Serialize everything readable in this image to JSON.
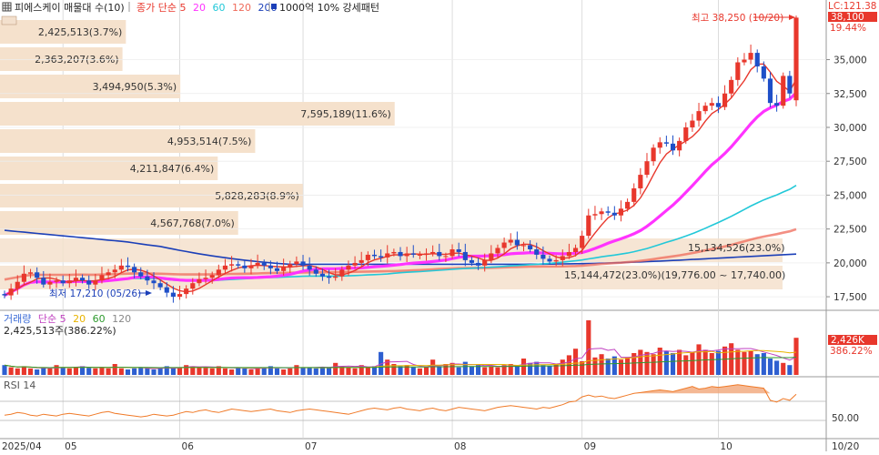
{
  "header": {
    "menu_icon": "grid-menu-icon",
    "title": "피에스케이 매물대 수(10)",
    "ma_legend": [
      {
        "text": "종가 단순 5",
        "color": "#e8372c"
      },
      {
        "text": "20",
        "color": "#ff33ff"
      },
      {
        "text": "60",
        "color": "#22c8d8"
      },
      {
        "text": "120",
        "color": "#ef6a5a"
      },
      {
        "text": "200",
        "color": "#1b3fb8"
      }
    ],
    "pattern_label": "1000억 10% 강세패턴",
    "lc_label": "LC:121.38"
  },
  "price_tags": {
    "current": "38,100",
    "current_pct": "19.44%",
    "current_bg": "#e8372c"
  },
  "annotations": {
    "high": "최고 38,250 (10/20)",
    "low": "최저 17,210 (05/26)",
    "band_left": "15,144,472(23.0%)(19,776.00 ~ 17,740.00)",
    "band_right": "15,134,526(23.0%)"
  },
  "volume_panel": {
    "legend": [
      {
        "text": "거래량",
        "color": "#3a6bd6"
      },
      {
        "text": "단순 5",
        "color": "#c040c0"
      },
      {
        "text": "20",
        "color": "#e8b400"
      },
      {
        "text": "60",
        "color": "#2e9a2e"
      },
      {
        "text": "120",
        "color": "#888888"
      }
    ],
    "value_text": "2,425,513주(386.22%)",
    "tag": "2,426K",
    "tag_pct": "386.22%"
  },
  "rsi_panel": {
    "label": "RSI 14",
    "tick": "50.00"
  },
  "chart_data": {
    "type": "candlestick",
    "title": "피에스케이 매물대 수(10)",
    "y_axis_ticks": [
      "35,000",
      "32,500",
      "30,000",
      "27,500",
      "25,000",
      "22,500",
      "20,000",
      "17,500"
    ],
    "ylim": [
      16700,
      39200
    ],
    "x_axis_labels": [
      "2025/04",
      "05",
      "06",
      "07",
      "08",
      "09",
      "10",
      "10/20"
    ],
    "volume_profile": [
      {
        "label": "2,425,513(3.7%)",
        "share": 3.7
      },
      {
        "label": "2,363,207(3.6%)",
        "share": 3.6
      },
      {
        "label": "3,494,950(5.3%)",
        "share": 5.3
      },
      {
        "label": "7,595,189(11.6%)",
        "share": 11.6
      },
      {
        "label": "4,953,514(7.5%)",
        "share": 7.5
      },
      {
        "label": "4,211,847(6.4%)",
        "share": 6.4
      },
      {
        "label": "5,828,283(8.9%)",
        "share": 8.9
      },
      {
        "label": "4,567,768(7.0%)",
        "share": 7.0
      },
      {
        "label": "",
        "share": 23.0
      },
      {
        "label": "",
        "share": 23.0
      }
    ],
    "high": {
      "value": 38250,
      "date": "10/20"
    },
    "low": {
      "value": 17210,
      "date": "05/26"
    },
    "last_close": 38100,
    "month_ticks": [
      {
        "label": "2025/04",
        "idx": 0
      },
      {
        "label": "05",
        "idx": 9
      },
      {
        "label": "06",
        "idx": 27
      },
      {
        "label": "07",
        "idx": 46
      },
      {
        "label": "08",
        "idx": 69
      },
      {
        "label": "09",
        "idx": 89
      },
      {
        "label": "10",
        "idx": 110
      }
    ],
    "closes": [
      17600,
      18100,
      18600,
      19200,
      19300,
      18900,
      18400,
      18600,
      18700,
      18500,
      18700,
      18900,
      18700,
      18400,
      18700,
      19100,
      19300,
      19500,
      19800,
      19700,
      19300,
      19000,
      18700,
      18500,
      18200,
      17800,
      17500,
      17700,
      18100,
      18500,
      18800,
      18900,
      19100,
      19500,
      19800,
      19900,
      19800,
      19600,
      19800,
      20000,
      19800,
      19600,
      19400,
      19700,
      19900,
      20100,
      19800,
      19500,
      19200,
      19000,
      18900,
      19000,
      19500,
      19800,
      20000,
      20200,
      20600,
      20500,
      20400,
      20700,
      20800,
      20500,
      20700,
      20600,
      20600,
      20700,
      20800,
      20500,
      20500,
      21000,
      20800,
      20200,
      20000,
      19800,
      20200,
      20700,
      21100,
      21500,
      21700,
      21300,
      21300,
      21000,
      20600,
      20300,
      20100,
      20200,
      20500,
      20800,
      21100,
      22000,
      23500,
      23600,
      23800,
      23700,
      23500,
      24000,
      24500,
      25500,
      26500,
      27500,
      28500,
      28900,
      28800,
      28300,
      29000,
      30000,
      30500,
      31200,
      31600,
      31800,
      31500,
      32500,
      33500,
      34800,
      35000,
      35500,
      34500,
      33600,
      31800,
      31600,
      33800,
      32500,
      38100
    ],
    "opens": [
      17700,
      17600,
      18100,
      18600,
      19200,
      19300,
      18900,
      18400,
      18600,
      18700,
      18500,
      18700,
      18900,
      18700,
      18400,
      18700,
      19100,
      19300,
      19500,
      19800,
      19700,
      19300,
      19000,
      18700,
      18500,
      18200,
      17800,
      17500,
      17700,
      18100,
      18500,
      18800,
      18900,
      19100,
      19500,
      19800,
      19900,
      19800,
      19600,
      19800,
      20000,
      19800,
      19600,
      19400,
      19700,
      19900,
      20100,
      19800,
      19500,
      19200,
      19000,
      18900,
      19000,
      19500,
      19800,
      20000,
      20200,
      20600,
      20500,
      20400,
      20700,
      20800,
      20500,
      20700,
      20600,
      20600,
      20700,
      20800,
      20500,
      20500,
      21000,
      20800,
      20200,
      20000,
      19800,
      20200,
      20700,
      21100,
      21500,
      21700,
      21300,
      21300,
      21000,
      20600,
      20300,
      20100,
      20200,
      20500,
      20800,
      21100,
      22000,
      23500,
      23600,
      23800,
      23700,
      23500,
      24000,
      24500,
      25500,
      26500,
      27500,
      28500,
      28900,
      28800,
      28300,
      29000,
      30000,
      30500,
      31200,
      31600,
      31800,
      31500,
      32500,
      33500,
      34800,
      35000,
      35500,
      34500,
      33600,
      31800,
      31600,
      33800,
      32000
    ],
    "volume": [
      0.18,
      0.14,
      0.12,
      0.16,
      0.12,
      0.1,
      0.13,
      0.12,
      0.18,
      0.14,
      0.12,
      0.15,
      0.16,
      0.13,
      0.12,
      0.14,
      0.12,
      0.2,
      0.12,
      0.1,
      0.12,
      0.14,
      0.12,
      0.1,
      0.12,
      0.16,
      0.12,
      0.14,
      0.18,
      0.16,
      0.14,
      0.13,
      0.12,
      0.16,
      0.12,
      0.1,
      0.14,
      0.12,
      0.1,
      0.13,
      0.14,
      0.16,
      0.12,
      0.1,
      0.12,
      0.18,
      0.14,
      0.13,
      0.12,
      0.15,
      0.14,
      0.22,
      0.16,
      0.14,
      0.12,
      0.18,
      0.14,
      0.16,
      0.42,
      0.28,
      0.2,
      0.16,
      0.18,
      0.14,
      0.12,
      0.14,
      0.28,
      0.16,
      0.2,
      0.22,
      0.14,
      0.24,
      0.16,
      0.18,
      0.14,
      0.16,
      0.14,
      0.18,
      0.2,
      0.16,
      0.3,
      0.22,
      0.24,
      0.18,
      0.16,
      0.2,
      0.28,
      0.36,
      0.48,
      0.25,
      1.0,
      0.32,
      0.38,
      0.3,
      0.34,
      0.28,
      0.32,
      0.4,
      0.46,
      0.42,
      0.38,
      0.5,
      0.44,
      0.4,
      0.46,
      0.36,
      0.42,
      0.56,
      0.46,
      0.4,
      0.44,
      0.52,
      0.58,
      0.46,
      0.42,
      0.44,
      0.38,
      0.4,
      0.3,
      0.26,
      0.22,
      0.18,
      0.68
    ],
    "rsi": [
      45,
      46,
      48,
      47,
      45,
      44,
      46,
      45,
      44,
      46,
      47,
      46,
      45,
      44,
      46,
      48,
      49,
      47,
      46,
      45,
      44,
      43,
      44,
      46,
      45,
      44,
      45,
      47,
      49,
      48,
      50,
      51,
      49,
      48,
      50,
      52,
      51,
      50,
      49,
      50,
      51,
      52,
      50,
      49,
      48,
      50,
      51,
      52,
      51,
      50,
      49,
      48,
      47,
      46,
      48,
      50,
      52,
      53,
      52,
      51,
      53,
      54,
      52,
      51,
      50,
      52,
      53,
      51,
      50,
      52,
      54,
      53,
      52,
      51,
      50,
      52,
      54,
      55,
      56,
      55,
      54,
      53,
      52,
      54,
      53,
      55,
      57,
      60,
      61,
      66,
      68,
      66,
      67,
      65,
      64,
      66,
      68,
      70,
      71,
      72,
      73,
      74,
      73,
      72,
      74,
      76,
      78,
      75,
      76,
      78,
      77,
      78,
      79,
      80,
      79,
      78,
      77,
      76,
      62,
      60,
      64,
      62,
      69
    ]
  }
}
